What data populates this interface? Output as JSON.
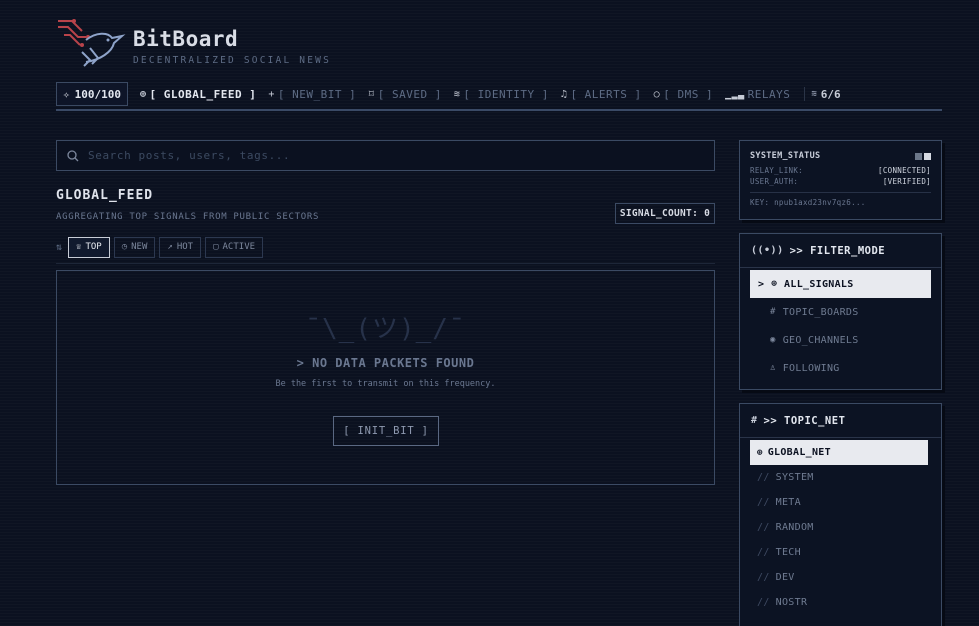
{
  "brand": {
    "title": "BitBoard",
    "subtitle": "DECENTRALIZED SOCIAL NEWS"
  },
  "nav": {
    "reputation": "100/100",
    "items": [
      {
        "label": "[ GLOBAL_FEED ]",
        "icon": "globe-icon"
      },
      {
        "label": "[ NEW_BIT ]",
        "icon": "plus-icon"
      },
      {
        "label": "[ SAVED ]",
        "icon": "bookmark-icon"
      },
      {
        "label": "[ IDENTITY ]",
        "icon": "wifi-icon"
      },
      {
        "label": "[ ALERTS ]",
        "icon": "bell-icon"
      },
      {
        "label": "[ DMS ]",
        "icon": "chat-icon"
      },
      {
        "label": "RELAYS",
        "icon": "signal-bars-icon"
      }
    ],
    "relay_count": "6/6"
  },
  "search": {
    "placeholder": "Search posts, users, tags..."
  },
  "feed": {
    "title": "GLOBAL_FEED",
    "subtitle": "AGGREGATING TOP SIGNALS FROM PUBLIC SECTORS",
    "signal_count": "SIGNAL_COUNT: 0",
    "sort": [
      {
        "label": "TOP",
        "active": true
      },
      {
        "label": "NEW",
        "active": false
      },
      {
        "label": "HOT",
        "active": false
      },
      {
        "label": "ACTIVE",
        "active": false
      }
    ]
  },
  "empty": {
    "shrug": "¯\\_(ツ)_/¯",
    "title": "> NO DATA PACKETS FOUND",
    "subtitle": "Be the first to transmit on this frequency.",
    "button": "[ INIT_BIT ]"
  },
  "status": {
    "title": "SYSTEM_STATUS",
    "relay_link_label": "RELAY_LINK:",
    "relay_link_value": "[CONNECTED]",
    "user_auth_label": "USER_AUTH:",
    "user_auth_value": "[VERIFIED]",
    "key": "KEY: npub1axd23nv7qz6..."
  },
  "filter": {
    "title": ">> FILTER_MODE",
    "items": [
      "ALL_SIGNALS",
      "TOPIC_BOARDS",
      "GEO_CHANNELS",
      "FOLLOWING"
    ],
    "active_prefix": ">"
  },
  "topics": {
    "title": ">> TOPIC_NET",
    "active": "GLOBAL_NET",
    "items": [
      "SYSTEM",
      "META",
      "RANDOM",
      "TECH",
      "DEV",
      "NOSTR"
    ],
    "prefix": "//"
  },
  "colors": {
    "background": "#0b1120",
    "border": "#3b4a63",
    "logo_red": "#b8434a",
    "logo_blue": "#8ea3c9"
  }
}
